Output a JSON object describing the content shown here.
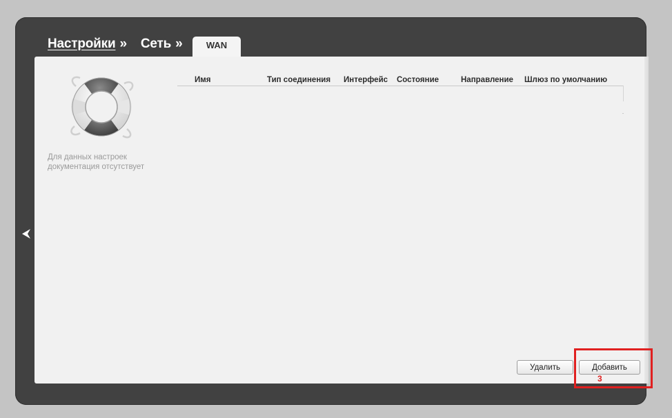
{
  "breadcrumb": {
    "items": [
      {
        "label": "Настройки",
        "separator": "»"
      },
      {
        "label": "Сеть",
        "separator": "»"
      }
    ]
  },
  "tabs": [
    {
      "label": "WAN",
      "active": true
    }
  ],
  "help": {
    "line1": "Для данных настроек",
    "line2": "документация отсутствует",
    "icon": "lifebuoy-icon"
  },
  "table": {
    "columns": [
      "Имя",
      "Тип соединения",
      "Интерфейс",
      "Состояние",
      "Направление",
      "Шлюз по умолчанию"
    ],
    "rows": []
  },
  "buttons": {
    "delete_label": "Удалить",
    "add_label": "Добавить"
  },
  "annotation": {
    "step_label": "3",
    "color": "#e02020"
  },
  "colors": {
    "frame": "#414141",
    "panel": "#f1f1f1",
    "highlight": "#e02020"
  }
}
